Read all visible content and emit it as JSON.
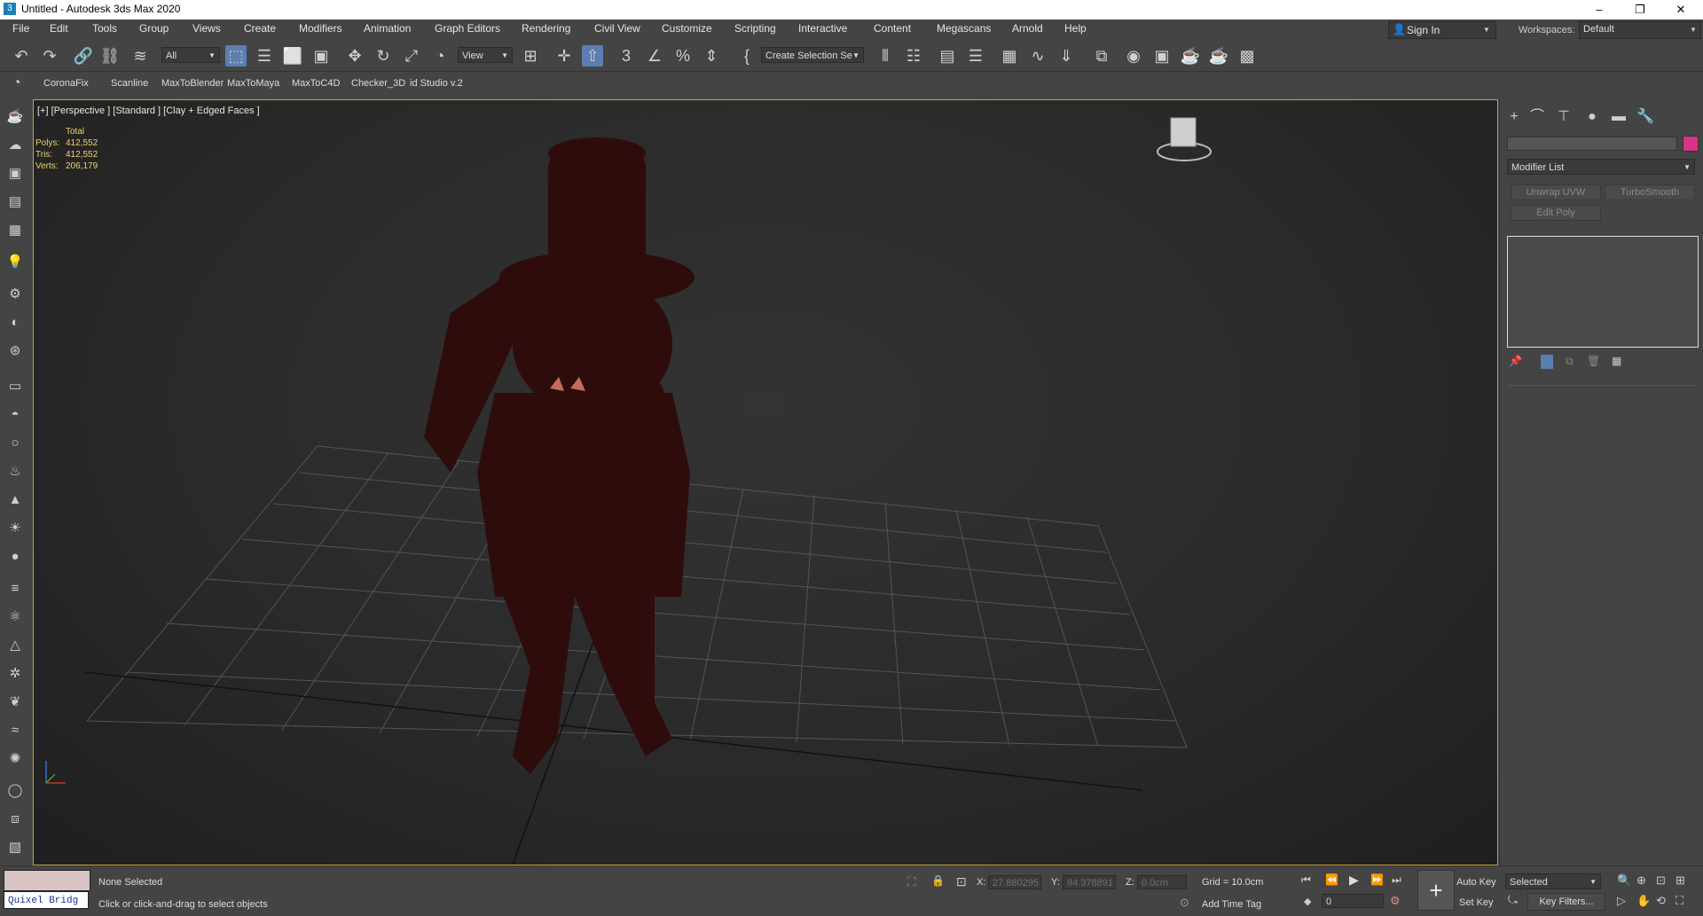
{
  "window": {
    "title": "Untitled - Autodesk 3ds Max 2020",
    "app_icon": "3",
    "controls": {
      "minimize": "–",
      "maximize": "❐",
      "close": "✕"
    }
  },
  "menu": [
    "File",
    "Edit",
    "Tools",
    "Group",
    "Views",
    "Create",
    "Modifiers",
    "Animation",
    "Graph Editors",
    "Rendering",
    "Civil View",
    "Customize",
    "Scripting",
    "Interactive",
    "Content",
    "Megascans",
    "Arnold",
    "Help"
  ],
  "signin": {
    "label": "Sign In"
  },
  "workspace": {
    "label": "Workspaces:",
    "value": "Default"
  },
  "toolbar": {
    "filter_value": "All",
    "view_value": "View",
    "selection_set_value": "Create Selection Se"
  },
  "toolbar2": {
    "plugins": [
      "CoronaFix",
      "Scanline",
      "MaxToBlender",
      "MaxToMaya",
      "MaxToC4D",
      "Checker_3D",
      "id Studio v.2"
    ]
  },
  "viewport": {
    "label": "[+] [Perspective ] [Standard ] [Clay + Edged Faces ]",
    "stats": {
      "header": "Total",
      "rows": [
        {
          "label": "Polys:",
          "value": "412,552"
        },
        {
          "label": "Tris:",
          "value": "412,552"
        },
        {
          "label": "Verts:",
          "value": "206,179"
        }
      ]
    }
  },
  "command_panel": {
    "modifier_list": "Modifier List",
    "buttons": [
      "Unwrap UVW",
      "TurboSmooth",
      "Edit Poly"
    ]
  },
  "status": {
    "quixel": "Quixel Bridg",
    "selection": "None Selected",
    "prompt": "Click or click-and-drag to select objects",
    "x_label": "X:",
    "x_value": "27.880295",
    "y_label": "Y:",
    "y_value": "94.378891",
    "z_label": "Z:",
    "z_value": "0.0cm",
    "grid": "Grid = 10.0cm",
    "add_time_tag": "Add Time Tag",
    "auto_key": "Auto Key",
    "set_key": "Set Key",
    "selected": "Selected",
    "key_filters": "Key Filters...",
    "frame": "0"
  }
}
